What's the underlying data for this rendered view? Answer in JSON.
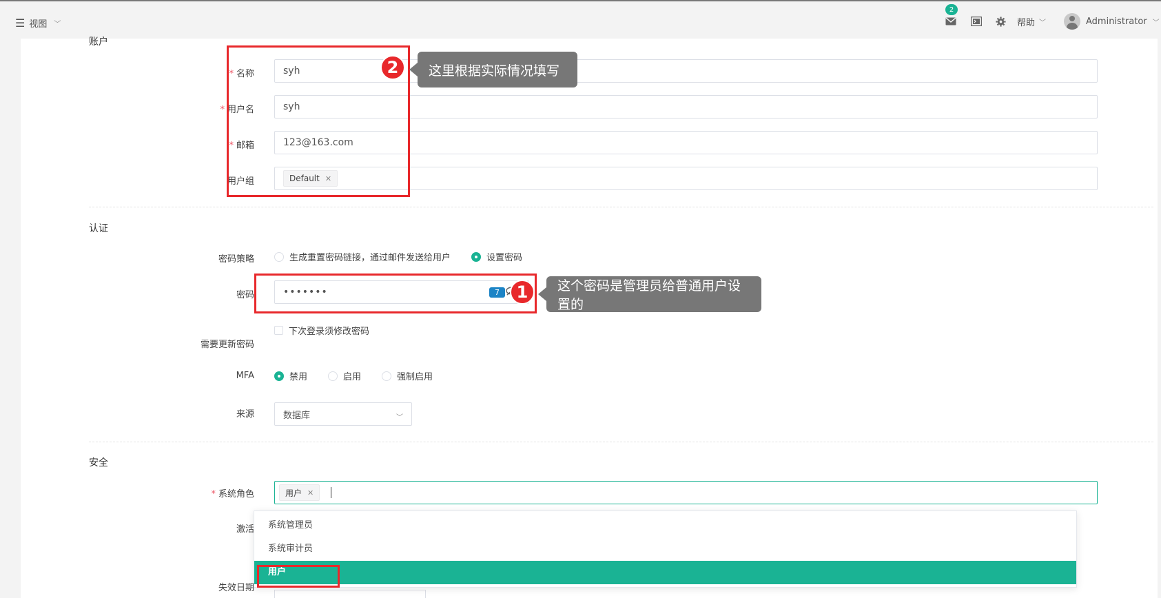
{
  "topbar": {
    "view_label": "视图",
    "mail_count": "2",
    "help_label": "帮助",
    "user_name": "Administrator"
  },
  "account": {
    "section_title": "账户",
    "name_label": "名称",
    "name_value": "syh",
    "username_label": "用户名",
    "username_value": "syh",
    "email_label": "邮箱",
    "email_value": "123@163.com",
    "group_label": "用户组",
    "group_tag": "Default"
  },
  "auth": {
    "section_title": "认证",
    "policy_label": "密码策略",
    "policy_options": [
      "生成重置密码链接，通过邮件发送给用户",
      "设置密码"
    ],
    "policy_selected": "设置密码",
    "password_label": "密码",
    "password_value": "•••••••",
    "password_length": "7",
    "need_update_label": "需要更新密码",
    "need_update_checkbox": "下次登录须修改密码",
    "mfa_label": "MFA",
    "mfa_options": [
      "禁用",
      "启用",
      "强制启用"
    ],
    "mfa_selected": "禁用",
    "source_label": "来源",
    "source_value": "数据库"
  },
  "security": {
    "section_title": "安全",
    "role_label": "系统角色",
    "role_tag": "用户",
    "active_label": "激活",
    "expire_label": "失效日期",
    "role_options": [
      "系统管理员",
      "系统审计员",
      "用户"
    ],
    "role_selected": "用户"
  },
  "annotations": {
    "callout_1": "这个密码是管理员给普通用户设置的",
    "callout_2": "这里根据实际情况填写",
    "badge_1": "1",
    "badge_2": "2"
  },
  "colors": {
    "accent": "#1ab394",
    "annotation_red": "#e8282b",
    "required_star": "#ed5565"
  }
}
